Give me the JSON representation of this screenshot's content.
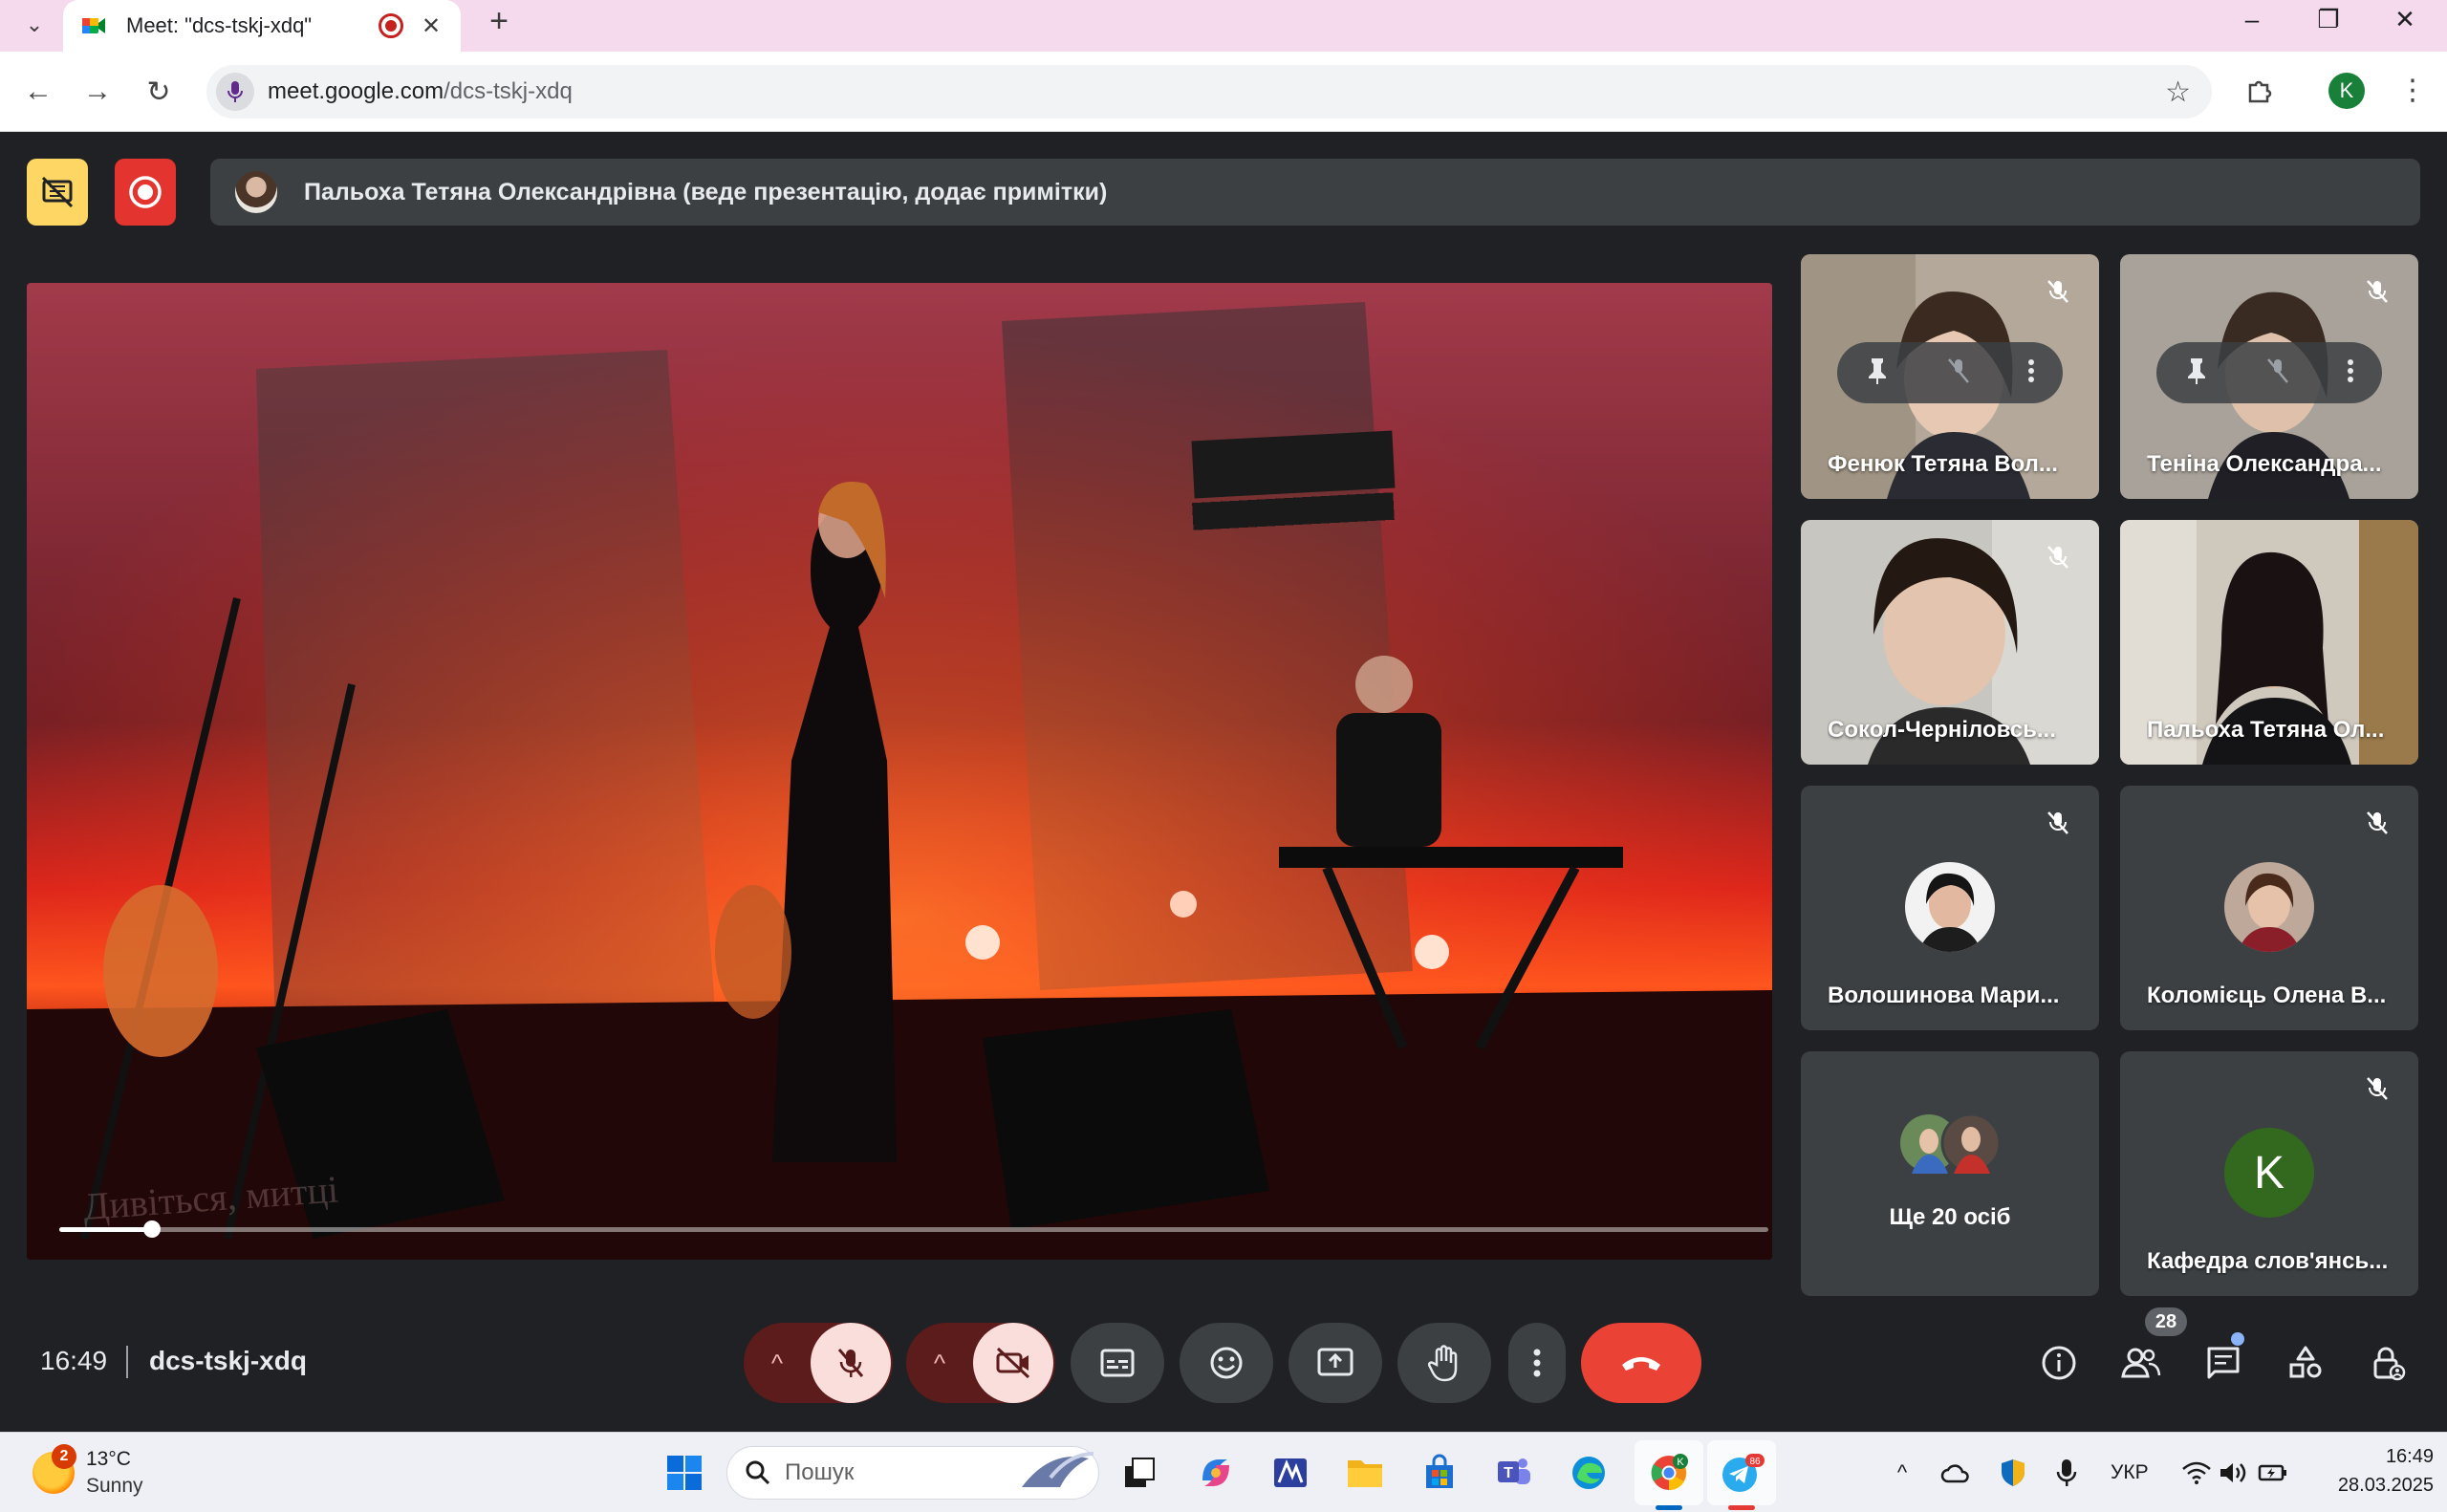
{
  "browser": {
    "tab_title": "Meet: \"dcs-tskj-xdq\"",
    "url_host": "meet.google.com",
    "url_path": "/dcs-tskj-xdq",
    "profile_initial": "K"
  },
  "meet": {
    "presenter_text": "Пальоха Тетяна Олександрівна (веде презентацію, додає примітки)",
    "video_progress": 0.054,
    "participants": [
      {
        "name": "Фенюк Тетяна Вол..."
      },
      {
        "name": "Теніна Олександра..."
      },
      {
        "name": "Сокол-Черніловсь..."
      },
      {
        "name": "Пальоха Тетяна Ол..."
      },
      {
        "name": "Волошинова Мари..."
      },
      {
        "name": "Коломієць Олена В..."
      },
      {
        "name": "Кафедра слов'янсь...",
        "initial": "K"
      }
    ],
    "more_people": "Ще 20 осіб",
    "clock": "16:49",
    "meeting_code": "dcs-tskj-xdq",
    "people_count": "28"
  },
  "taskbar": {
    "weather_temp": "13°C",
    "weather_desc": "Sunny",
    "weather_badge": "2",
    "search_placeholder": "Пошук",
    "telegram_badge": "86",
    "lang": "УКР",
    "time": "16:49",
    "date": "28.03.2025"
  },
  "colors": {
    "meet_bg": "#202124",
    "tile_bg": "#3c4043",
    "end_call": "#ea4335",
    "stage_red": "#c8141e"
  }
}
